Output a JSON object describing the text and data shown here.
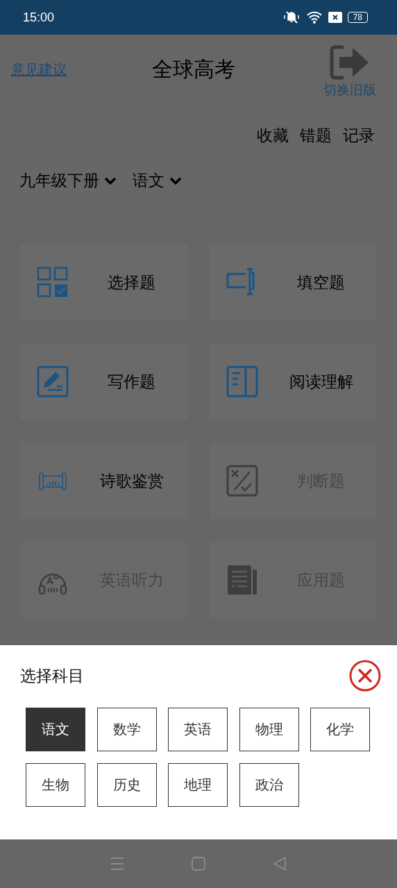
{
  "status_bar": {
    "time": "15:00",
    "battery": "78"
  },
  "header": {
    "feedback_link": "意见建议",
    "title": "全球高考",
    "switch_label": "切换旧版"
  },
  "shortcuts": [
    "收藏",
    "错题",
    "记录"
  ],
  "filters": [
    {
      "label": "九年级下册"
    },
    {
      "label": "语文"
    }
  ],
  "question_types": [
    {
      "label": "选择题",
      "kind": "choice",
      "enabled": true
    },
    {
      "label": "填空题",
      "kind": "blank",
      "enabled": true
    },
    {
      "label": "写作题",
      "kind": "writing",
      "enabled": true
    },
    {
      "label": "阅读理解",
      "kind": "reading",
      "enabled": true
    },
    {
      "label": "诗歌鉴赏",
      "kind": "poetry",
      "enabled": true
    },
    {
      "label": "判断题",
      "kind": "judge",
      "enabled": false
    },
    {
      "label": "英语听力",
      "kind": "listening",
      "enabled": false
    },
    {
      "label": "应用题",
      "kind": "application",
      "enabled": false
    }
  ],
  "subject_sheet": {
    "title": "选择科目",
    "subjects": [
      {
        "label": "语文",
        "selected": true
      },
      {
        "label": "数学",
        "selected": false
      },
      {
        "label": "英语",
        "selected": false
      },
      {
        "label": "物理",
        "selected": false
      },
      {
        "label": "化学",
        "selected": false
      },
      {
        "label": "生物",
        "selected": false
      },
      {
        "label": "历史",
        "selected": false
      },
      {
        "label": "地理",
        "selected": false
      },
      {
        "label": "政治",
        "selected": false
      }
    ]
  }
}
